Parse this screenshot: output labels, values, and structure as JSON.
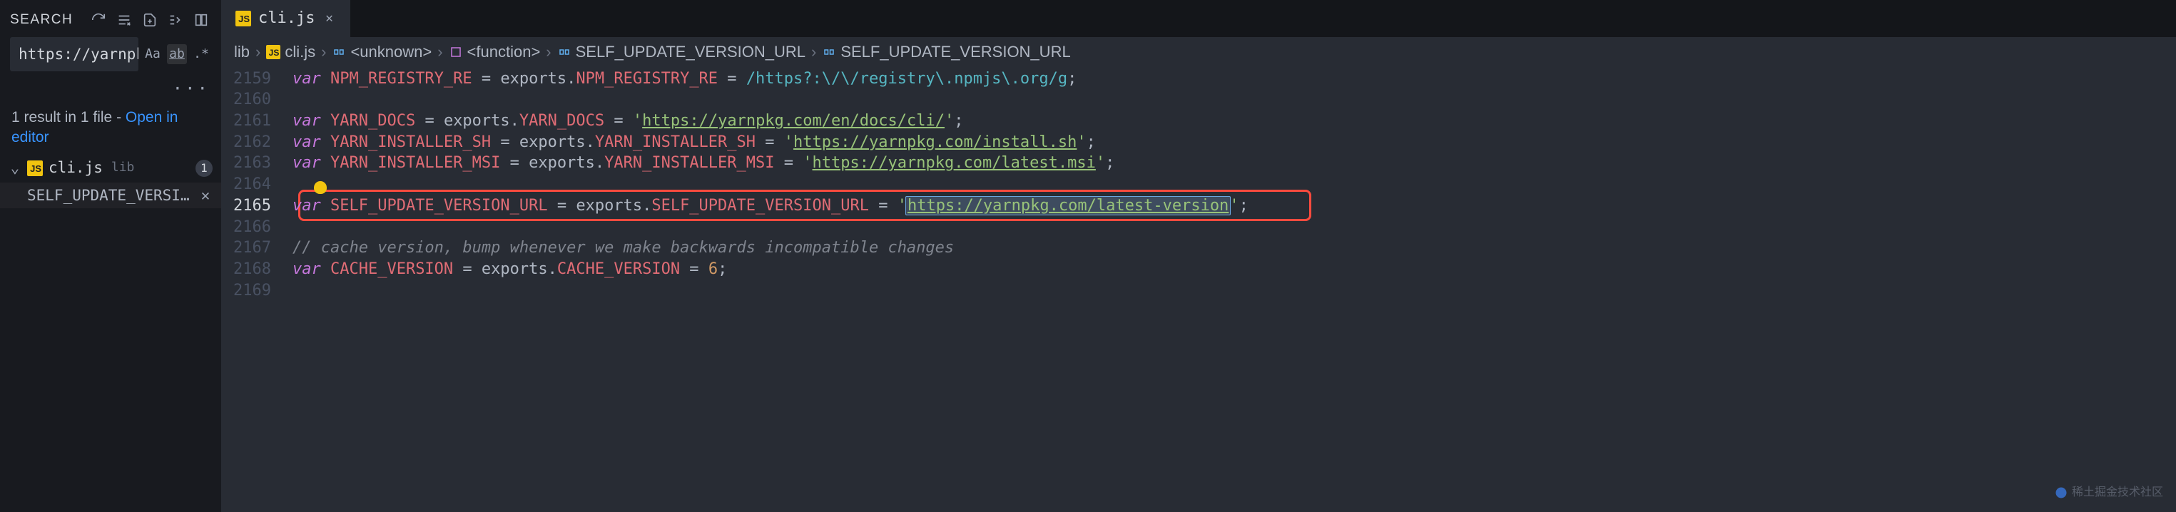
{
  "sidebar": {
    "title": "SEARCH",
    "query": "https://yarnpkg.com/latest-version",
    "opts": {
      "case": "Aa",
      "word": "ab",
      "regex": ".*"
    },
    "summary_prefix": "1 result in 1 file - ",
    "summary_link": "Open in editor",
    "file": {
      "name": "cli.js",
      "path": "lib",
      "count": "1"
    },
    "result_text": "SELF_UPDATE_VERSI..."
  },
  "tab": {
    "name": "cli.js"
  },
  "breadcrumbs": {
    "folder": "lib",
    "file": "cli.js",
    "seg1": "<unknown>",
    "seg2": "<function>",
    "seg3": "SELF_UPDATE_VERSION_URL",
    "seg4": "SELF_UPDATE_VERSION_URL"
  },
  "gutter": [
    "2159",
    "2160",
    "2161",
    "2162",
    "2163",
    "2164",
    "2165",
    "2166",
    "2167",
    "2168",
    "2169"
  ],
  "code": {
    "l0": {
      "kw": "var ",
      "v": "NPM_REGISTRY_RE",
      "mid": " = exports.",
      "p": "NPM_REGISTRY_RE",
      "post": " = ",
      "rx": "/https?:\\/\\/registry\\.npmjs\\.org/g",
      "end": ";"
    },
    "l2": {
      "kw": "var ",
      "v": "YARN_DOCS",
      "mid": " = exports.",
      "p": "YARN_DOCS",
      "post": " = ",
      "q": "'",
      "s": "https://yarnpkg.com/en/docs/cli/",
      "end": ";"
    },
    "l3": {
      "kw": "var ",
      "v": "YARN_INSTALLER_SH",
      "mid": " = exports.",
      "p": "YARN_INSTALLER_SH",
      "post": " = ",
      "q": "'",
      "s": "https://yarnpkg.com/install.sh",
      "end": ";"
    },
    "l4": {
      "kw": "var ",
      "v": "YARN_INSTALLER_MSI",
      "mid": " = exports.",
      "p": "YARN_INSTALLER_MSI",
      "post": " = ",
      "q": "'",
      "s": "https://yarnpkg.com/latest.msi",
      "end": ";"
    },
    "l6": {
      "kw": "var ",
      "v": "SELF_UPDATE_VERSION_URL",
      "mid": " = exports.",
      "p": "SELF_UPDATE_VERSION_URL",
      "post": " = ",
      "q": "'",
      "s": "https://yarnpkg.com/latest-version",
      "end": ";"
    },
    "l8": {
      "c": "// cache version, bump whenever we make backwards incompatible changes"
    },
    "l9": {
      "kw": "var ",
      "v": "CACHE_VERSION",
      "mid": " = exports.",
      "p": "CACHE_VERSION",
      "post": " = ",
      "n": "6",
      "end": ";"
    }
  },
  "watermark": "稀土掘金技术社区"
}
